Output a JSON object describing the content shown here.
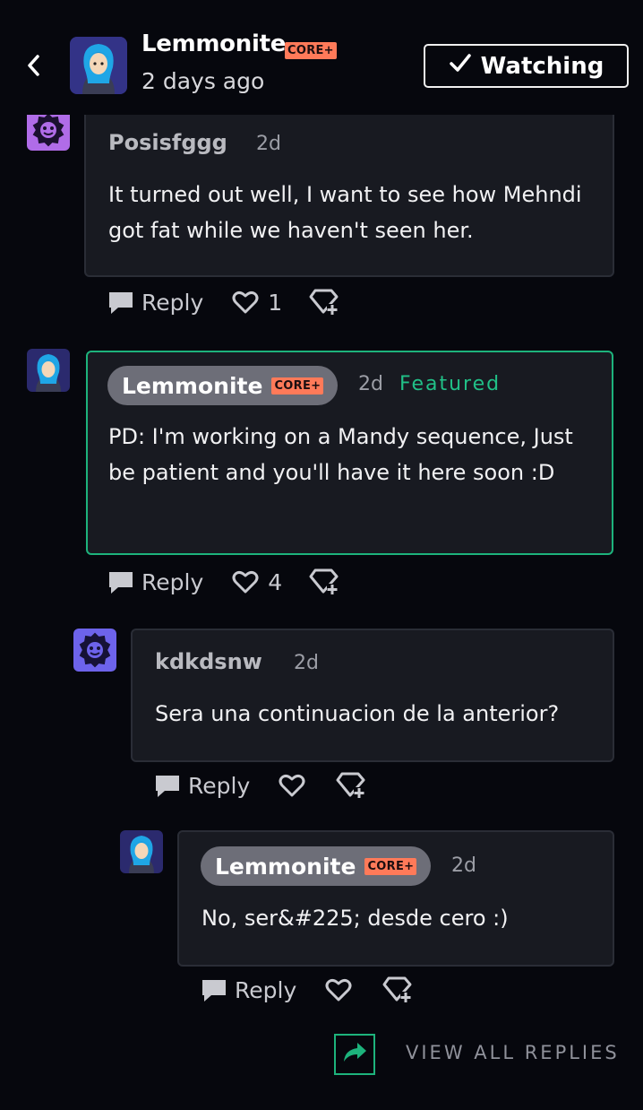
{
  "header": {
    "author": "Lemmonite",
    "badge": "CORE+",
    "time": "2 days ago",
    "watch_label": "Watching"
  },
  "comments": [
    {
      "author": "Posisfggg",
      "time": "2d",
      "body": "It turned out well, I want to see how Mehndi got fat while we haven't seen her.",
      "reply_label": "Reply",
      "likes": "1"
    },
    {
      "author": "Lemmonite",
      "badge": "CORE+",
      "time": "2d",
      "featured_label": "Featured",
      "body": "PD: I'm working on a Mandy sequence, Just be patient and you'll have it here soon :D",
      "reply_label": "Reply",
      "likes": "4"
    },
    {
      "author": "kdkdsnw",
      "time": "2d",
      "body": "Sera una continuacion de la anterior?",
      "reply_label": "Reply"
    },
    {
      "author": "Lemmonite",
      "badge": "CORE+",
      "time": "2d",
      "body": "No, ser&#225; desde cero :)",
      "reply_label": "Reply"
    }
  ],
  "view_all_label": "VIEW ALL REPLIES",
  "colors": {
    "background": "#06070d",
    "card": "#181a21",
    "featured": "#1db37c",
    "badge": "#ff7a59"
  },
  "icons": [
    "chevron-left-icon",
    "check-icon",
    "reply-icon",
    "heart-icon",
    "award-icon",
    "share-icon"
  ]
}
